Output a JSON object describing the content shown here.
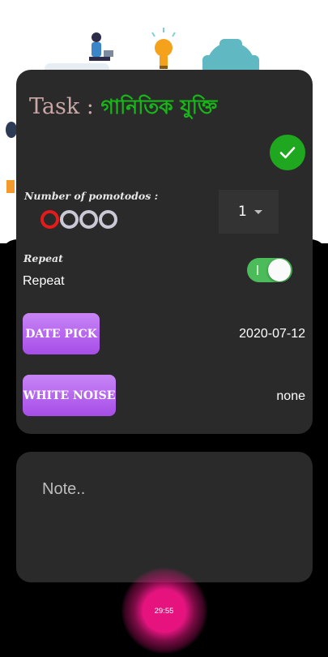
{
  "task": {
    "prefix": "Task : ",
    "name": "গানিতিক যুক্তি"
  },
  "confirm_icon": "check-icon",
  "pomodoros": {
    "label": "Number of pomotodos :",
    "total": 4,
    "active": 1,
    "selected_count": "1"
  },
  "repeat": {
    "heading": "Repeat",
    "label": "Repeat",
    "enabled": true
  },
  "date_pick": {
    "button_label": "DATE PICK",
    "value": "2020-07-12"
  },
  "white_noise": {
    "button_label": "WHITE NOISE",
    "value": "none"
  },
  "note": {
    "placeholder": "Note.."
  },
  "timer": {
    "value": "29:55"
  },
  "colors": {
    "card": "#2a2a2a",
    "accent_green": "#1fa71f",
    "task_name": "#18b718",
    "purple": "#b065ee",
    "timer_pink": "#e6137f",
    "dot_active": "#e51a1a"
  }
}
